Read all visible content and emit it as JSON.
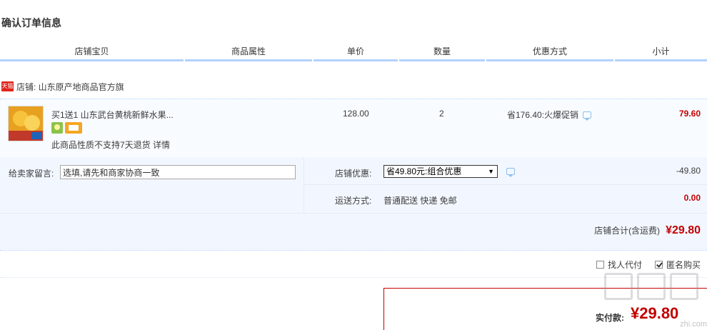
{
  "page": {
    "title": "确认订单信息"
  },
  "table_header": {
    "columns": [
      "店铺宝贝",
      "商品属性",
      "单价",
      "数量",
      "优惠方式",
      "小计"
    ]
  },
  "shop": {
    "badge": "天猫",
    "label": "店铺: 山东原产地商品官方旗"
  },
  "item": {
    "title": "买1送1 山东武台黄桃新鲜水果...",
    "unit_price": "128.00",
    "quantity": "2",
    "promo": "省176.40:火爆促销",
    "subtotal": "79.60",
    "no_return_text": "此商品性质不支持7天退货 详情",
    "thumbnail_icon": "yellow-peach-product-image"
  },
  "memo": {
    "label": "给卖家留言:",
    "value": "选填,请先和商家协商一致"
  },
  "shop_promo": {
    "label": "店铺优惠:",
    "selected": "省49.80元:组合优惠",
    "amount": "-49.80"
  },
  "shipping": {
    "label": "运送方式:",
    "value": "普通配送 快递 免邮",
    "fee": "0.00"
  },
  "shop_total": {
    "label": "店铺合计(含运费)",
    "amount": "¥29.80"
  },
  "options": {
    "proxy_pay": "找人代付",
    "proxy_pay_checked": false,
    "anonymous": "匿名购买",
    "anonymous_checked": true
  },
  "payment": {
    "label": "实付款:",
    "amount": "¥29.80"
  },
  "watermark": {
    "text": "zhi.com"
  },
  "colors": {
    "price_red": "#c40000",
    "header_border": "#b2d1ff",
    "block_bg": "#f2f7ff"
  }
}
